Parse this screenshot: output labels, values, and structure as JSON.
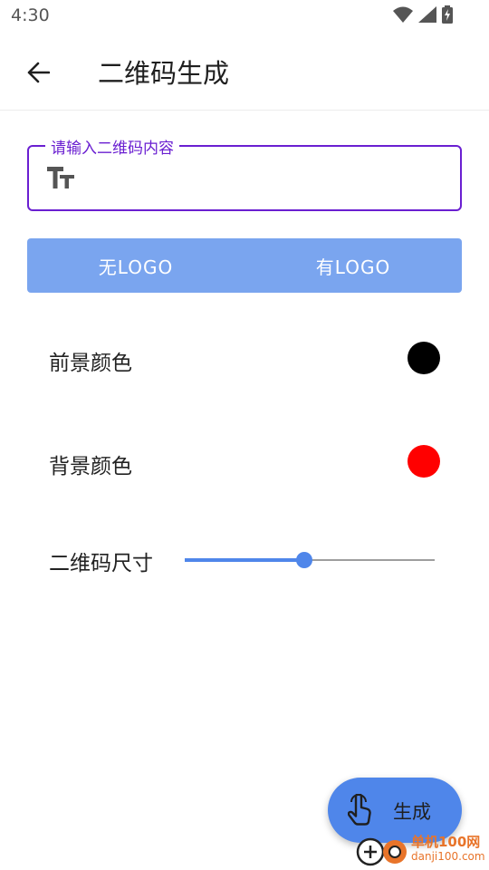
{
  "status_bar": {
    "time": "4:30"
  },
  "app_bar": {
    "title": "二维码生成"
  },
  "input": {
    "label": "请输入二维码内容",
    "value": ""
  },
  "logo_toggle": {
    "options": [
      "无LOGO",
      "有LOGO"
    ]
  },
  "settings": {
    "foreground": {
      "label": "前景颜色",
      "color": "#000000"
    },
    "background": {
      "label": "背景颜色",
      "color": "#ff0000"
    },
    "size": {
      "label": "二维码尺寸",
      "value_fraction": 0.48
    }
  },
  "fab": {
    "label": "生成"
  },
  "watermark": {
    "brand": "单机100网",
    "url": "danji100.com"
  },
  "colors": {
    "accent": "#4f86ea",
    "focus": "#6a1fd1",
    "toggle_bg": "#7aa5ef"
  }
}
